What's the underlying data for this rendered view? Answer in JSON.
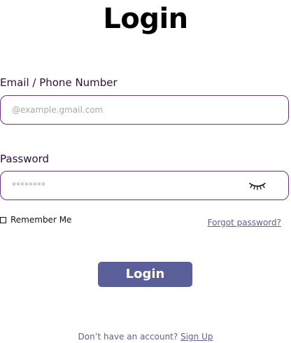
{
  "page": {
    "title": "Login"
  },
  "email": {
    "label": "Email / Phone Number",
    "placeholder": "@example.gmail.com",
    "value": ""
  },
  "password": {
    "label": "Password",
    "placeholder": "********",
    "value": "",
    "toggle_icon": "closed-eye-icon"
  },
  "remember": {
    "label": "Remember Me",
    "checked": false
  },
  "forgot_password": {
    "label": "Forgot password?"
  },
  "login_button": {
    "label": "Login",
    "color": "#5b5f99"
  },
  "signup": {
    "prompt": "Don’t have an account?",
    "link_label": "Sign Up"
  },
  "colors": {
    "field_border": "#6a3a78",
    "link": "#5b6290",
    "label_text": "#2a0f3a"
  }
}
